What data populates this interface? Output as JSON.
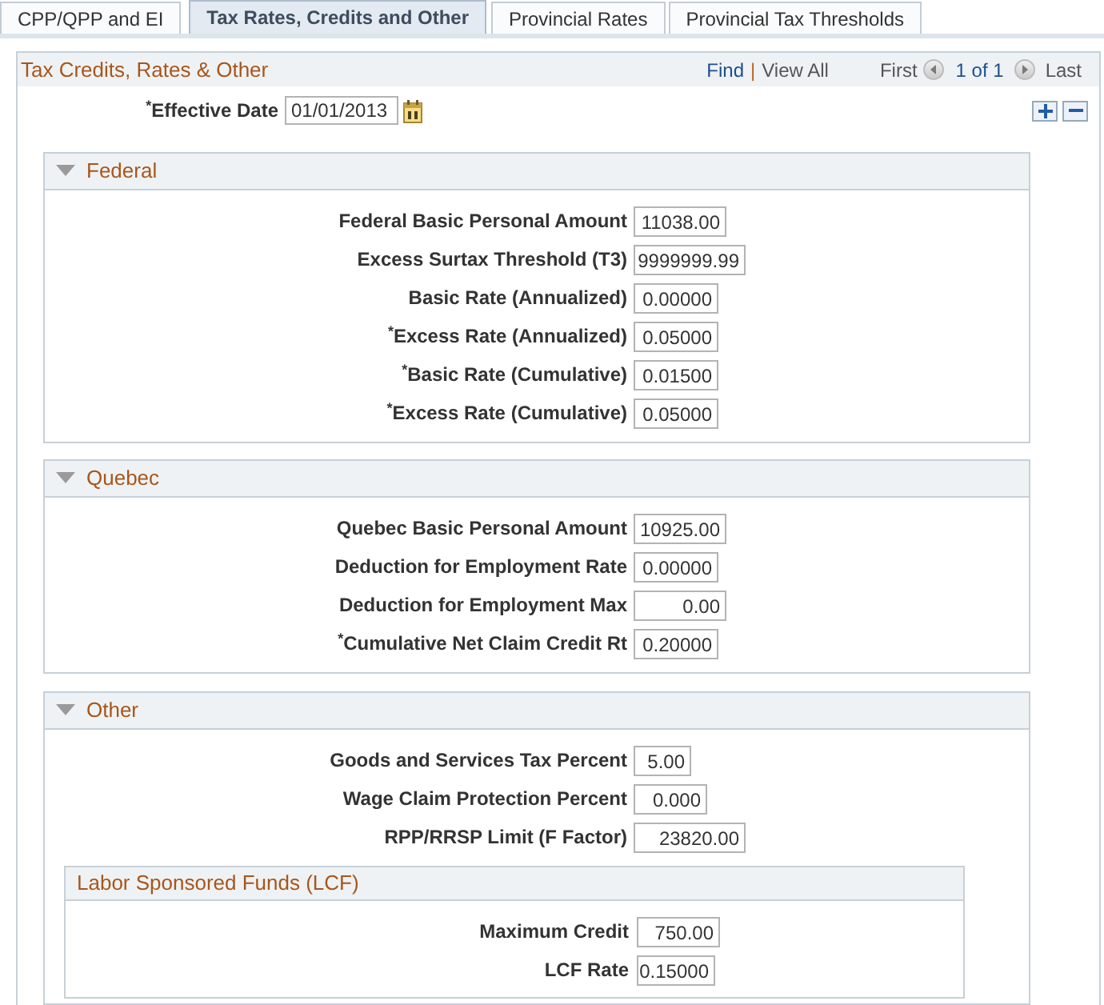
{
  "tabs": [
    {
      "label": "CPP/QPP and EI",
      "selected": false
    },
    {
      "label": "Tax Rates, Credits and Other",
      "selected": true
    },
    {
      "label": "Provincial Rates",
      "selected": false
    },
    {
      "label": "Provincial Tax Thresholds",
      "selected": false
    }
  ],
  "panel": {
    "title": "Tax Credits, Rates & Other",
    "find": "Find",
    "separator": "|",
    "view_all": "View All",
    "first": "First",
    "page_count": "1 of 1",
    "last": "Last"
  },
  "effective_date": {
    "label": "$^{*}$Effective Date",
    "value": "01/01/2013"
  },
  "sections": [
    {
      "title": "Federal",
      "expanded": true,
      "fields": [
        {
          "label": "Federal Basic Personal Amount",
          "value": "11038.00"
        },
        {
          "label": "Excess Surtax Threshold (T3)",
          "value": "9999999.99"
        },
        {
          "label": "Basic Rate (Annualized)",
          "value": "0.00000"
        },
        {
          "label": "$^{*}$Excess Rate (Annualized)",
          "value": "0.05000"
        },
        {
          "label": "$^{*}$Basic Rate (Cumulative)",
          "value": "0.01500"
        },
        {
          "label": "$^{*}$Excess Rate (Cumulative)",
          "value": "0.05000"
        }
      ]
    },
    {
      "title": "Quebec",
      "expanded": true,
      "fields": [
        {
          "label": "Quebec Basic Personal Amount",
          "value": "10925.00"
        },
        {
          "label": "Deduction for Employment Rate",
          "value": "0.00000"
        },
        {
          "label": "Deduction for Employment Max",
          "value": "0.00"
        },
        {
          "label": "$^{*}$Cumulative Net Claim Credit Rt",
          "value": "0.20000"
        }
      ]
    },
    {
      "title": "Other",
      "expanded": true,
      "fields": [
        {
          "label": "Goods and Services Tax Percent",
          "value": "5.00"
        },
        {
          "label": "Wage Claim Protection Percent",
          "value": "0.000"
        },
        {
          "label": "RPP/RRSP Limit (F Factor)",
          "value": "23820.00"
        }
      ],
      "subsections": [
        {
          "title": "Labor Sponsored Funds (LCF)",
          "fields": [
            {
              "label": "Maximum Credit",
              "value": "750.00"
            },
            {
              "label": "LCF Rate",
              "value": "0.15000"
            }
          ]
        }
      ]
    }
  ]
}
